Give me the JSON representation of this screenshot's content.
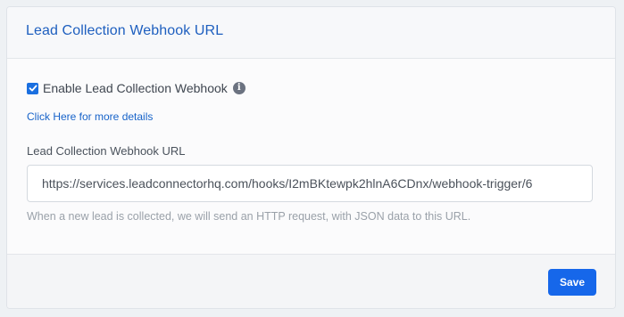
{
  "card": {
    "title": "Lead Collection Webhook URL"
  },
  "enable_webhook": {
    "label": "Enable Lead Collection Webhook",
    "checked": true,
    "info_icon": "info-icon"
  },
  "details_link": {
    "text": "Click Here for more details"
  },
  "webhook_url": {
    "label": "Lead Collection Webhook URL",
    "value": "https://services.leadconnectorhq.com/hooks/I2mBKtewpk2hlnA6CDnx/webhook-trigger/6",
    "help": "When a new lead is collected, we will send an HTTP request, with JSON data to this URL."
  },
  "footer": {
    "save_label": "Save"
  },
  "colors": {
    "accent": "#1667ea",
    "title": "#1e5fbf",
    "link": "#1763c9"
  }
}
